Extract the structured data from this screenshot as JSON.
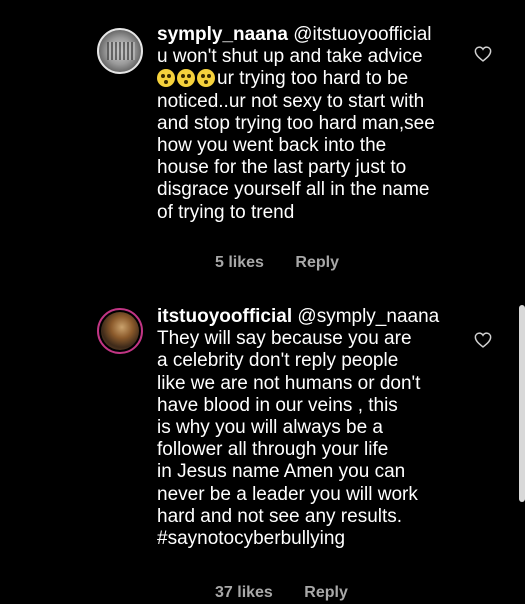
{
  "comments": [
    {
      "username": "symply_naana",
      "lines": [
        "@itstuoyoofficial",
        "u won't shut up and take advice",
        "ur trying too hard to be",
        "noticed..ur not sexy to start with",
        "and stop trying too hard man,see",
        "how you went back into the",
        "house for the last party just to",
        "disgrace yourself all in the name",
        "of trying to trend"
      ],
      "likes": "5 likes",
      "reply": "Reply",
      "emoji_icon": "flushed-face-emoji",
      "emoji_count": 3
    },
    {
      "username": "itstuoyoofficial",
      "lines": [
        "@symply_naana",
        "They will say because you are",
        "a celebrity don't reply people",
        "like we are not humans or don't",
        "have blood in our veins , this",
        "is why you will always be a",
        "follower all through your life",
        "in Jesus name Amen  you can",
        "never be a leader you  will work",
        "hard and not see any results.",
        "#saynotocyberbullying"
      ],
      "likes": "37 likes",
      "reply": "Reply"
    }
  ],
  "colors": {
    "background": "#000000",
    "text": "#ffffff",
    "meta": "#a8a8a8",
    "story_ring": "#c13584"
  },
  "icons": {
    "like": "heart-outline-icon"
  }
}
